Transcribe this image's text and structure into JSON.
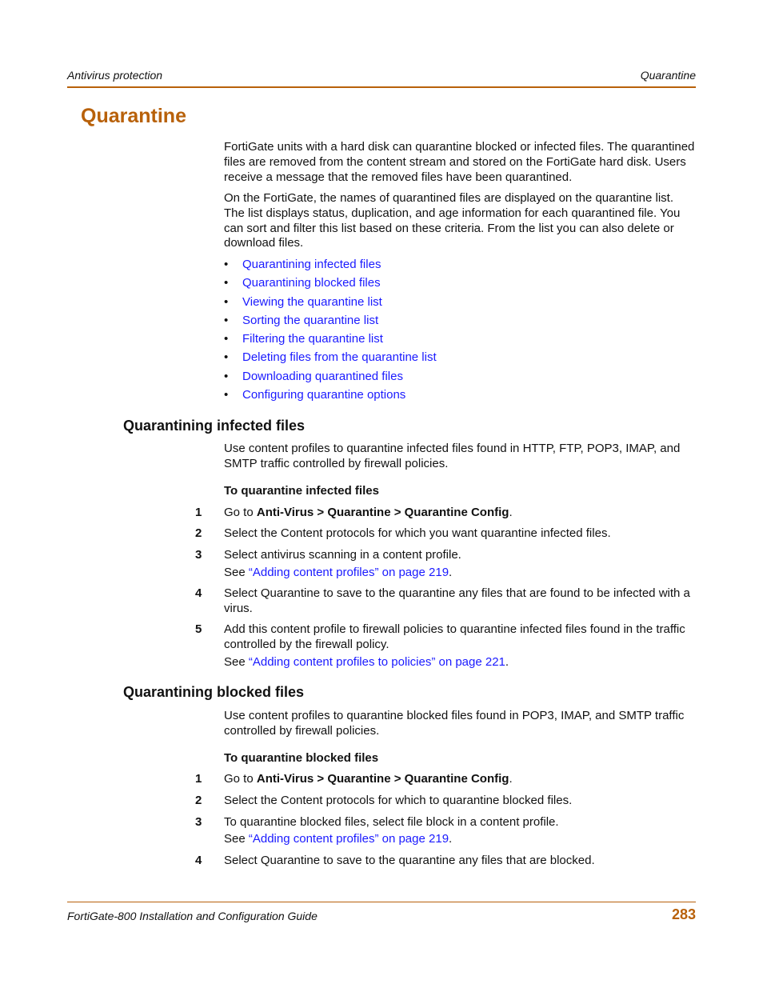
{
  "header": {
    "left": "Antivirus protection",
    "right": "Quarantine"
  },
  "title": "Quarantine",
  "intro": [
    "FortiGate units with a hard disk can quarantine blocked or infected files. The quarantined files are removed from the content stream and stored on the FortiGate hard disk. Users receive a message that the removed files have been quarantined.",
    "On the FortiGate, the names of quarantined files are displayed on the quarantine list. The list displays status, duplication, and age information for each quarantined file. You can sort and filter this list based on these criteria. From the list you can also delete or download files."
  ],
  "toc": [
    "Quarantining infected files",
    "Quarantining blocked files",
    "Viewing the quarantine list",
    "Sorting the quarantine list",
    "Filtering the quarantine list",
    "Deleting files from the quarantine list",
    "Downloading quarantined files",
    "Configuring quarantine options"
  ],
  "bullet": "•",
  "section1": {
    "heading": "Quarantining infected files",
    "para": "Use content profiles to quarantine infected files found in HTTP, FTP, POP3, IMAP, and SMTP traffic controlled by firewall policies.",
    "procedure": "To quarantine infected files",
    "steps": [
      {
        "num": "1",
        "pre": "Go to ",
        "bold": "Anti-Virus > Quarantine > Quarantine Config",
        "post": "."
      },
      {
        "num": "2",
        "text": "Select the Content protocols for which you want quarantine infected files."
      },
      {
        "num": "3",
        "text": "Select antivirus scanning in a content profile.",
        "see_pre": "See ",
        "see_link": "“Adding content profiles” on page 219",
        "see_post": "."
      },
      {
        "num": "4",
        "text": "Select Quarantine to save to the quarantine any files that are found to be infected with a virus."
      },
      {
        "num": "5",
        "text": "Add this content profile to firewall policies to quarantine infected files found in the traffic controlled by the firewall policy.",
        "see_pre": "See ",
        "see_link": "“Adding content profiles to policies” on page 221",
        "see_post": "."
      }
    ]
  },
  "section2": {
    "heading": "Quarantining blocked files",
    "para": "Use content profiles to quarantine blocked files found in POP3, IMAP, and SMTP traffic controlled by firewall policies.",
    "procedure": "To quarantine blocked files",
    "steps": [
      {
        "num": "1",
        "pre": "Go to ",
        "bold": "Anti-Virus > Quarantine > Quarantine Config",
        "post": "."
      },
      {
        "num": "2",
        "text": "Select the Content protocols for which to quarantine blocked files."
      },
      {
        "num": "3",
        "text": "To quarantine blocked files, select file block in a content profile.",
        "see_pre": "See ",
        "see_link": "“Adding content profiles” on page 219",
        "see_post": "."
      },
      {
        "num": "4",
        "text": "Select Quarantine to save to the quarantine any files that are blocked."
      }
    ]
  },
  "footer": {
    "left": "FortiGate-800 Installation and Configuration Guide",
    "page": "283"
  },
  "colors": {
    "accent": "#b8610a",
    "link": "#1a1aff",
    "text": "#111111"
  }
}
